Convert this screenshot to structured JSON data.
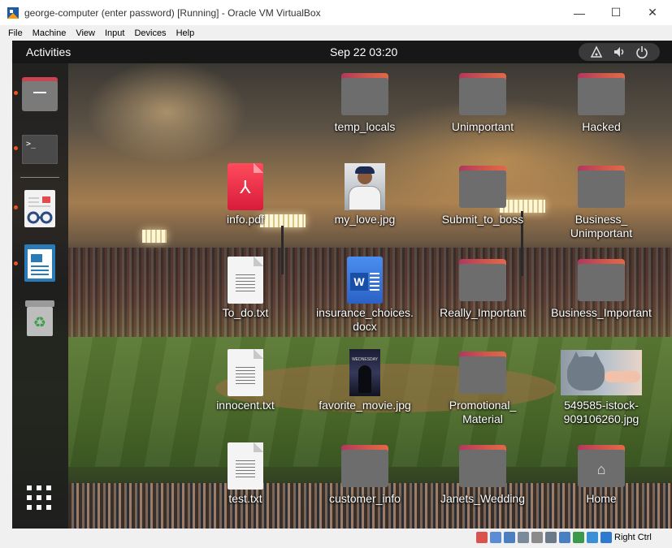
{
  "window": {
    "title": "george-computer (enter password) [Running] - Oracle VM VirtualBox",
    "minimize": "—",
    "maximize": "☐",
    "close": "✕"
  },
  "menu": [
    "File",
    "Machine",
    "View",
    "Input",
    "Devices",
    "Help"
  ],
  "topbar": {
    "activities": "Activities",
    "clock": "Sep 22  03:20",
    "tray_icons": [
      "network-icon",
      "volume-icon",
      "power-icon"
    ]
  },
  "dock": {
    "items": [
      "files-icon",
      "terminal-icon",
      "document-viewer-icon",
      "libreoffice-writer-icon",
      "trash-icon"
    ],
    "running": [
      true,
      true,
      true,
      true,
      false
    ],
    "show_apps": "show-applications-icon"
  },
  "desktop": {
    "row1": [
      "temp_locals",
      "Unimportant",
      "Hacked"
    ],
    "row2": [
      "info.pdf",
      "my_love.jpg",
      "Submit_to_boss",
      "Business_\nUnimportant"
    ],
    "row3": [
      "To_do.txt",
      "insurance_choices.\ndocx",
      "Really_Important",
      "Business_Important"
    ],
    "row4": [
      "innocent.txt",
      "favorite_movie.jpg",
      "Promotional_\nMaterial",
      "549585-istock-\n909106260.jpg"
    ],
    "row5": [
      "test.txt",
      "customer_info",
      "Janets_Wedding",
      "Home"
    ],
    "poster_text": "WEDNESDAY"
  },
  "statusbar": {
    "host_key": "Right Ctrl"
  },
  "colors": {
    "folder_tab": "#d3584a",
    "folder_body": "#6d6d6d",
    "ubuntu_orange": "#e95420",
    "gnome_bar": "#171717"
  }
}
